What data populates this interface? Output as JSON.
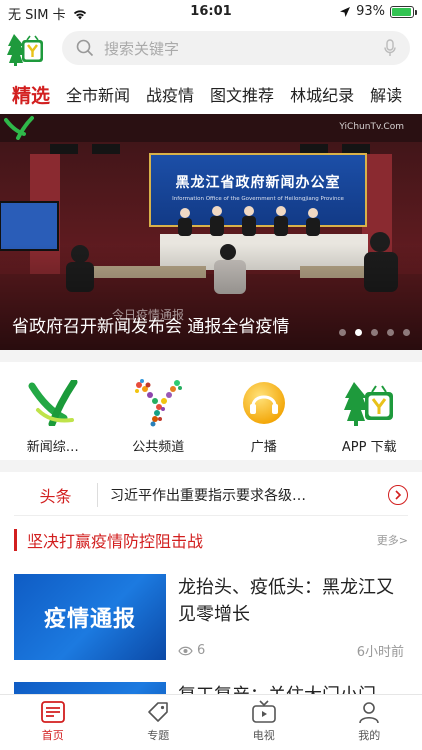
{
  "status_bar": {
    "carrier": "无 SIM 卡",
    "time": "16:01",
    "battery": "93%",
    "battery_level": 0.93
  },
  "header": {
    "search_placeholder": "搜索关键字"
  },
  "tabs": [
    {
      "label": "精选",
      "active": true
    },
    {
      "label": "全市新闻"
    },
    {
      "label": "战疫情"
    },
    {
      "label": "图文推荐"
    },
    {
      "label": "林城纪录"
    },
    {
      "label": "解读"
    }
  ],
  "banner": {
    "caption": "省政府召开新闻发布会 通报全省疫情",
    "sign_text": "黑龙江省政府新闻办公室",
    "sign_subtext": "Information Office of the Government of Heilongjiang Province",
    "watermark": "今日疫情通报",
    "site_mark": "YiChunTv.Com",
    "slide_count": 5,
    "active_slide": 2
  },
  "entries": [
    {
      "label": "新闻综…",
      "icon": "news-channel-logo-icon"
    },
    {
      "label": "公共频道",
      "icon": "public-channel-logo-icon"
    },
    {
      "label": "广播",
      "icon": "radio-headphones-icon"
    },
    {
      "label": "APP 下载",
      "icon": "app-download-tv-icon"
    }
  ],
  "ticker": {
    "tag": "头条",
    "text": "习近平作出重要指示要求各级…"
  },
  "topic": {
    "title": "坚决打赢疫情防控阻击战",
    "more": "更多>"
  },
  "news": [
    {
      "title": "龙抬头、疫低头：黑龙江又见零增长",
      "thumb_text": "疫情通报",
      "views": "6",
      "time": "6小时前"
    },
    {
      "title": "复工复产：关住大门小门",
      "thumb_text": "",
      "views": "",
      "time": ""
    }
  ],
  "tabbar": [
    {
      "label": "首页",
      "icon": "home-news-icon",
      "active": true
    },
    {
      "label": "专题",
      "icon": "tag-icon"
    },
    {
      "label": "电视",
      "icon": "tv-icon"
    },
    {
      "label": "我的",
      "icon": "user-icon"
    }
  ],
  "colors": {
    "accent": "#d21f1f",
    "logo_green": "#1e9a3c",
    "banner_red": "#6b1a1f"
  }
}
